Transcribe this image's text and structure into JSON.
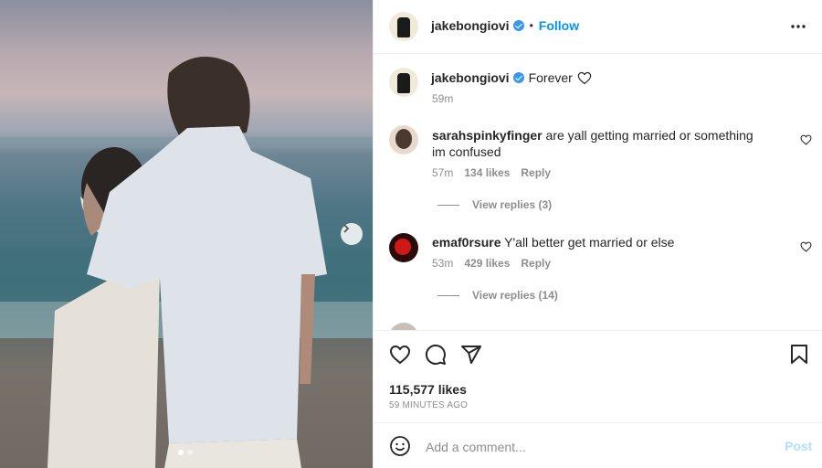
{
  "post": {
    "username": "jakebongiovi",
    "separator": "•",
    "follow_label": "Follow",
    "more_icon": "more-horizontal-icon",
    "caption_text": "Forever",
    "caption_time": "59m",
    "likes": "115,577 likes",
    "time_ago": "59 MINUTES AGO"
  },
  "comments": [
    {
      "username": "sarahspinkyfinger",
      "text": "are yall getting married or something im confused",
      "time": "57m",
      "likes": "134 likes",
      "reply_label": "Reply",
      "view_replies": "View replies (3)"
    },
    {
      "username": "emaf0rsure",
      "text": "Y'all better get married or else",
      "time": "53m",
      "likes": "429 likes",
      "reply_label": "Reply",
      "view_replies": "View replies (14)"
    }
  ],
  "composer": {
    "placeholder": "Add a comment...",
    "post_label": "Post"
  },
  "carousel": {
    "total": 2,
    "current": 1
  },
  "colors": {
    "accent": "#0095f6",
    "verified": "#3897f0",
    "post_disabled": "#b2dffc",
    "muted_text": "#8e8e8e"
  }
}
